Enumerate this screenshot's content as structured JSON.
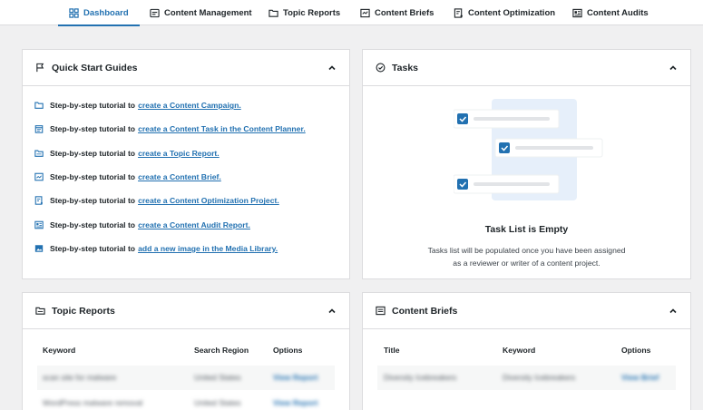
{
  "tabs": [
    {
      "label": "Dashboard",
      "icon": "dashboard-icon",
      "active": true
    },
    {
      "label": "Content Management",
      "icon": "content-management-icon"
    },
    {
      "label": "Topic Reports",
      "icon": "folder-icon"
    },
    {
      "label": "Content Briefs",
      "icon": "brief-icon"
    },
    {
      "label": "Content Optimization",
      "icon": "optimization-icon"
    },
    {
      "label": "Content Audits",
      "icon": "audit-icon"
    }
  ],
  "quick_start": {
    "title": "Quick Start Guides",
    "prefix": "Step-by-step tutorial to",
    "items": [
      {
        "link": "create a Content Campaign.",
        "icon": "folder-icon"
      },
      {
        "link": "create a Content Task in the Content Planner.",
        "icon": "calendar-icon"
      },
      {
        "link": "create a Topic Report.",
        "icon": "folder-icon"
      },
      {
        "link": "create a Content Brief.",
        "icon": "brief-icon"
      },
      {
        "link": "create a Content Optimization Project.",
        "icon": "optimization-icon"
      },
      {
        "link": "create a Content Audit Report.",
        "icon": "audit-icon"
      },
      {
        "link": "add a new image in the Media Library.",
        "icon": "image-icon"
      }
    ]
  },
  "tasks": {
    "title": "Tasks",
    "empty_title": "Task List is Empty",
    "empty_desc_line1": "Tasks list will be populated once you have been assigned",
    "empty_desc_line2": "as a reviewer or writer of a content project."
  },
  "topic_reports": {
    "title": "Topic Reports",
    "columns": [
      "Keyword",
      "Search Region",
      "Options"
    ],
    "rows": [
      [
        "scan site for malware",
        "United States",
        "View Report"
      ],
      [
        "WordPress malware removal",
        "United States",
        "View Report"
      ]
    ]
  },
  "content_briefs": {
    "title": "Content Briefs",
    "columns": [
      "Title",
      "Keyword",
      "Options"
    ],
    "rows": [
      [
        "Diversity Icebreakers",
        "Diversity Icebreakers",
        "View Brief"
      ]
    ]
  },
  "colors": {
    "accent": "#2271b1",
    "border": "#dcdcde",
    "background": "#f0f0f1"
  }
}
